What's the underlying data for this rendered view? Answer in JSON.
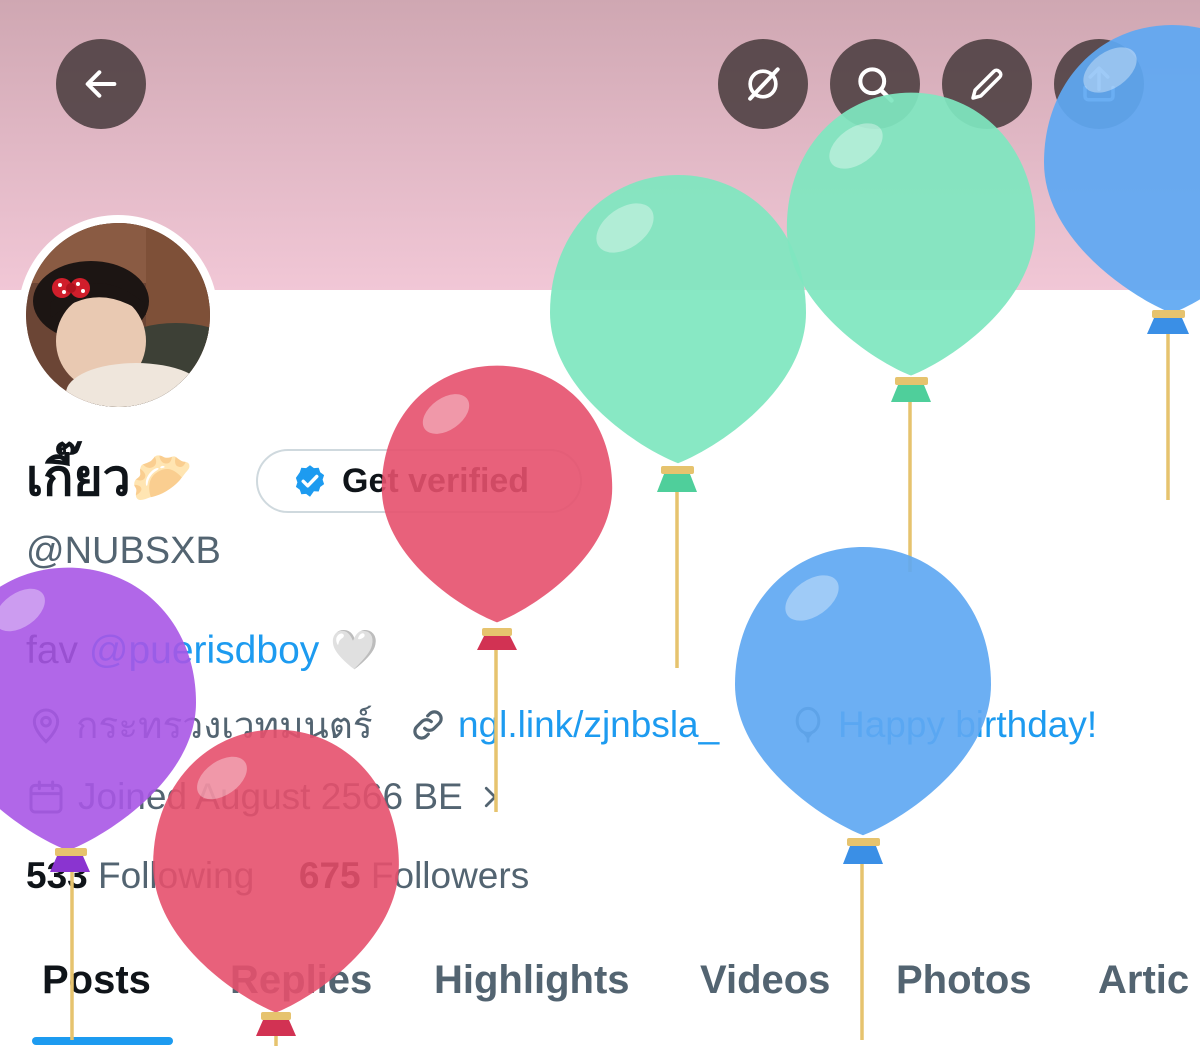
{
  "header": {
    "back_icon": "arrow-left-icon",
    "actions": [
      "grok-icon",
      "search-icon",
      "edit-icon",
      "share-icon"
    ]
  },
  "profile": {
    "display_name": "เกี๊ยว",
    "display_name_emoji": "🥟",
    "get_verified_label": "Get verified",
    "handle": "@NUBSXB",
    "bio_prefix": "fav ",
    "bio_mention": "@puerisdboy",
    "bio_emoji": "🤍",
    "location": "กระทรวงเวทมนตร์",
    "link": "ngl.link/zjnbsla_",
    "birthday": "Happy birthday!",
    "joined": "Joined August 2566 BE",
    "following_count": "533",
    "following_label": "Following",
    "followers_count": "675",
    "followers_label": "Followers"
  },
  "tabs": [
    {
      "label": "Posts",
      "active": true
    },
    {
      "label": "Replies",
      "active": false
    },
    {
      "label": "Highlights",
      "active": false
    },
    {
      "label": "Videos",
      "active": false
    },
    {
      "label": "Photos",
      "active": false
    },
    {
      "label": "Artic",
      "active": false
    }
  ],
  "colors": {
    "accent": "#1d9bf0",
    "muted_text": "#536471",
    "banner": "#dfb6c3",
    "balloon_green": "#7ee6bd",
    "balloon_red": "#e6546f",
    "balloon_blue": "#5ea9f2",
    "balloon_purple": "#b069e8"
  }
}
